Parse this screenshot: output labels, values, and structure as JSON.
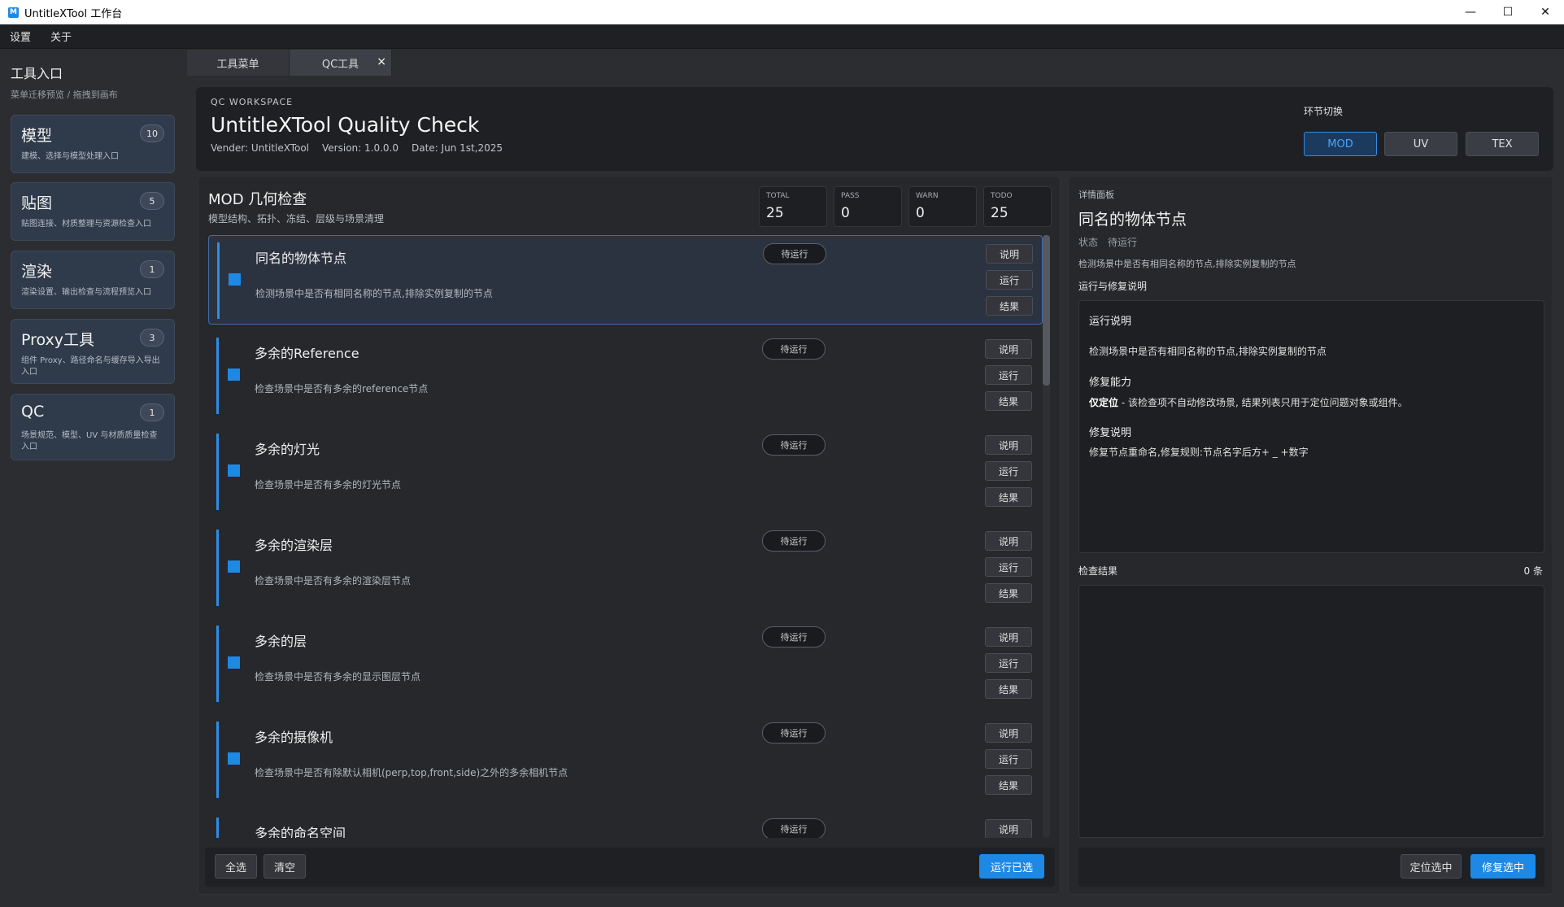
{
  "window": {
    "title": "UntitleXTool 工作台",
    "icon": "M",
    "minimize": "—",
    "maximize": "☐",
    "close": "✕"
  },
  "menu": [
    "设置",
    "关于"
  ],
  "sidebar": {
    "title": "工具入口",
    "subtitle": "菜单迁移预览 / 拖拽到画布",
    "cards": [
      {
        "name": "模型",
        "count": "10",
        "desc": "建模、选择与模型处理入口"
      },
      {
        "name": "贴图",
        "count": "5",
        "desc": "贴图连接、材质整理与资源检查入口"
      },
      {
        "name": "渲染",
        "count": "1",
        "desc": "渲染设置、输出检查与流程预览入口"
      },
      {
        "name": "Proxy工具",
        "count": "3",
        "desc": "组件 Proxy、路径命名与缓存导入导出入口"
      },
      {
        "name": "QC",
        "count": "1",
        "desc": "场景规范、模型、UV 与材质质量检查入口"
      }
    ]
  },
  "tabs": [
    {
      "label": "工具菜单"
    },
    {
      "label": "QC工具",
      "close": "×"
    }
  ],
  "header": {
    "kicker": "QC WORKSPACE",
    "title": "UntitleXTool Quality Check",
    "vender": "Vender: UntitleXTool",
    "version": "Version: 1.0.0.0",
    "date": "Date: Jun 1st,2025",
    "stage_label": "环节切换",
    "stages": [
      "MOD",
      "UV",
      "TEX"
    ],
    "active_stage": "MOD",
    "accent": "#2f8de4"
  },
  "panel": {
    "title": "MOD 几何检查",
    "subtitle": "模型结构、拓扑、冻结、层级与场景清理",
    "stats": [
      {
        "label": "TOTAL",
        "value": "25"
      },
      {
        "label": "PASS",
        "value": "0"
      },
      {
        "label": "WARN",
        "value": "0"
      },
      {
        "label": "TODO",
        "value": "25"
      }
    ],
    "items": [
      {
        "name": "同名的物体节点",
        "desc": "检测场景中是否有相同名称的节点,排除实例复制的节点",
        "status": "待运行"
      },
      {
        "name": "多余的Reference",
        "desc": "检查场景中是否有多余的reference节点",
        "status": "待运行"
      },
      {
        "name": "多余的灯光",
        "desc": "检查场景中是否有多余的灯光节点",
        "status": "待运行"
      },
      {
        "name": "多余的渲染层",
        "desc": "检查场景中是否有多余的渲染层节点",
        "status": "待运行"
      },
      {
        "name": "多余的层",
        "desc": "检查场景中是否有多余的显示图层节点",
        "status": "待运行"
      },
      {
        "name": "多余的摄像机",
        "desc": "检查场景中是否有除默认相机(perp,top,front,side)之外的多余相机节点",
        "status": "待运行"
      },
      {
        "name": "多余的命名空间",
        "desc": "",
        "status": "待运行"
      }
    ],
    "row_buttons": [
      "说明",
      "运行",
      "结果"
    ],
    "footer": {
      "select_all": "全选",
      "clear": "清空",
      "run_selected": "运行已选"
    }
  },
  "detail": {
    "kicker": "详情面板",
    "title": "同名的物体节点",
    "status_label": "状态",
    "status_value": "待运行",
    "desc": "检测场景中是否有相同名称的节点,排除实例复制的节点",
    "notes_heading": "运行与修复说明",
    "notes": {
      "run_h": "运行说明",
      "run_t": "检测场景中是否有相同名称的节点,排除实例复制的节点",
      "fix_cap_h": "修复能力",
      "fix_cap_bold": "仅定位",
      "fix_cap_t": " - 该检查项不自动修改场景, 结果列表只用于定位问题对象或组件。",
      "fix_h": "修复说明",
      "fix_t": "修复节点重命名,修复规则:节点名字后方+ _ +数字"
    },
    "results_heading": "检查结果",
    "results_count": "0 条",
    "footer": {
      "locate": "定位选中",
      "fix": "修复选中"
    }
  }
}
